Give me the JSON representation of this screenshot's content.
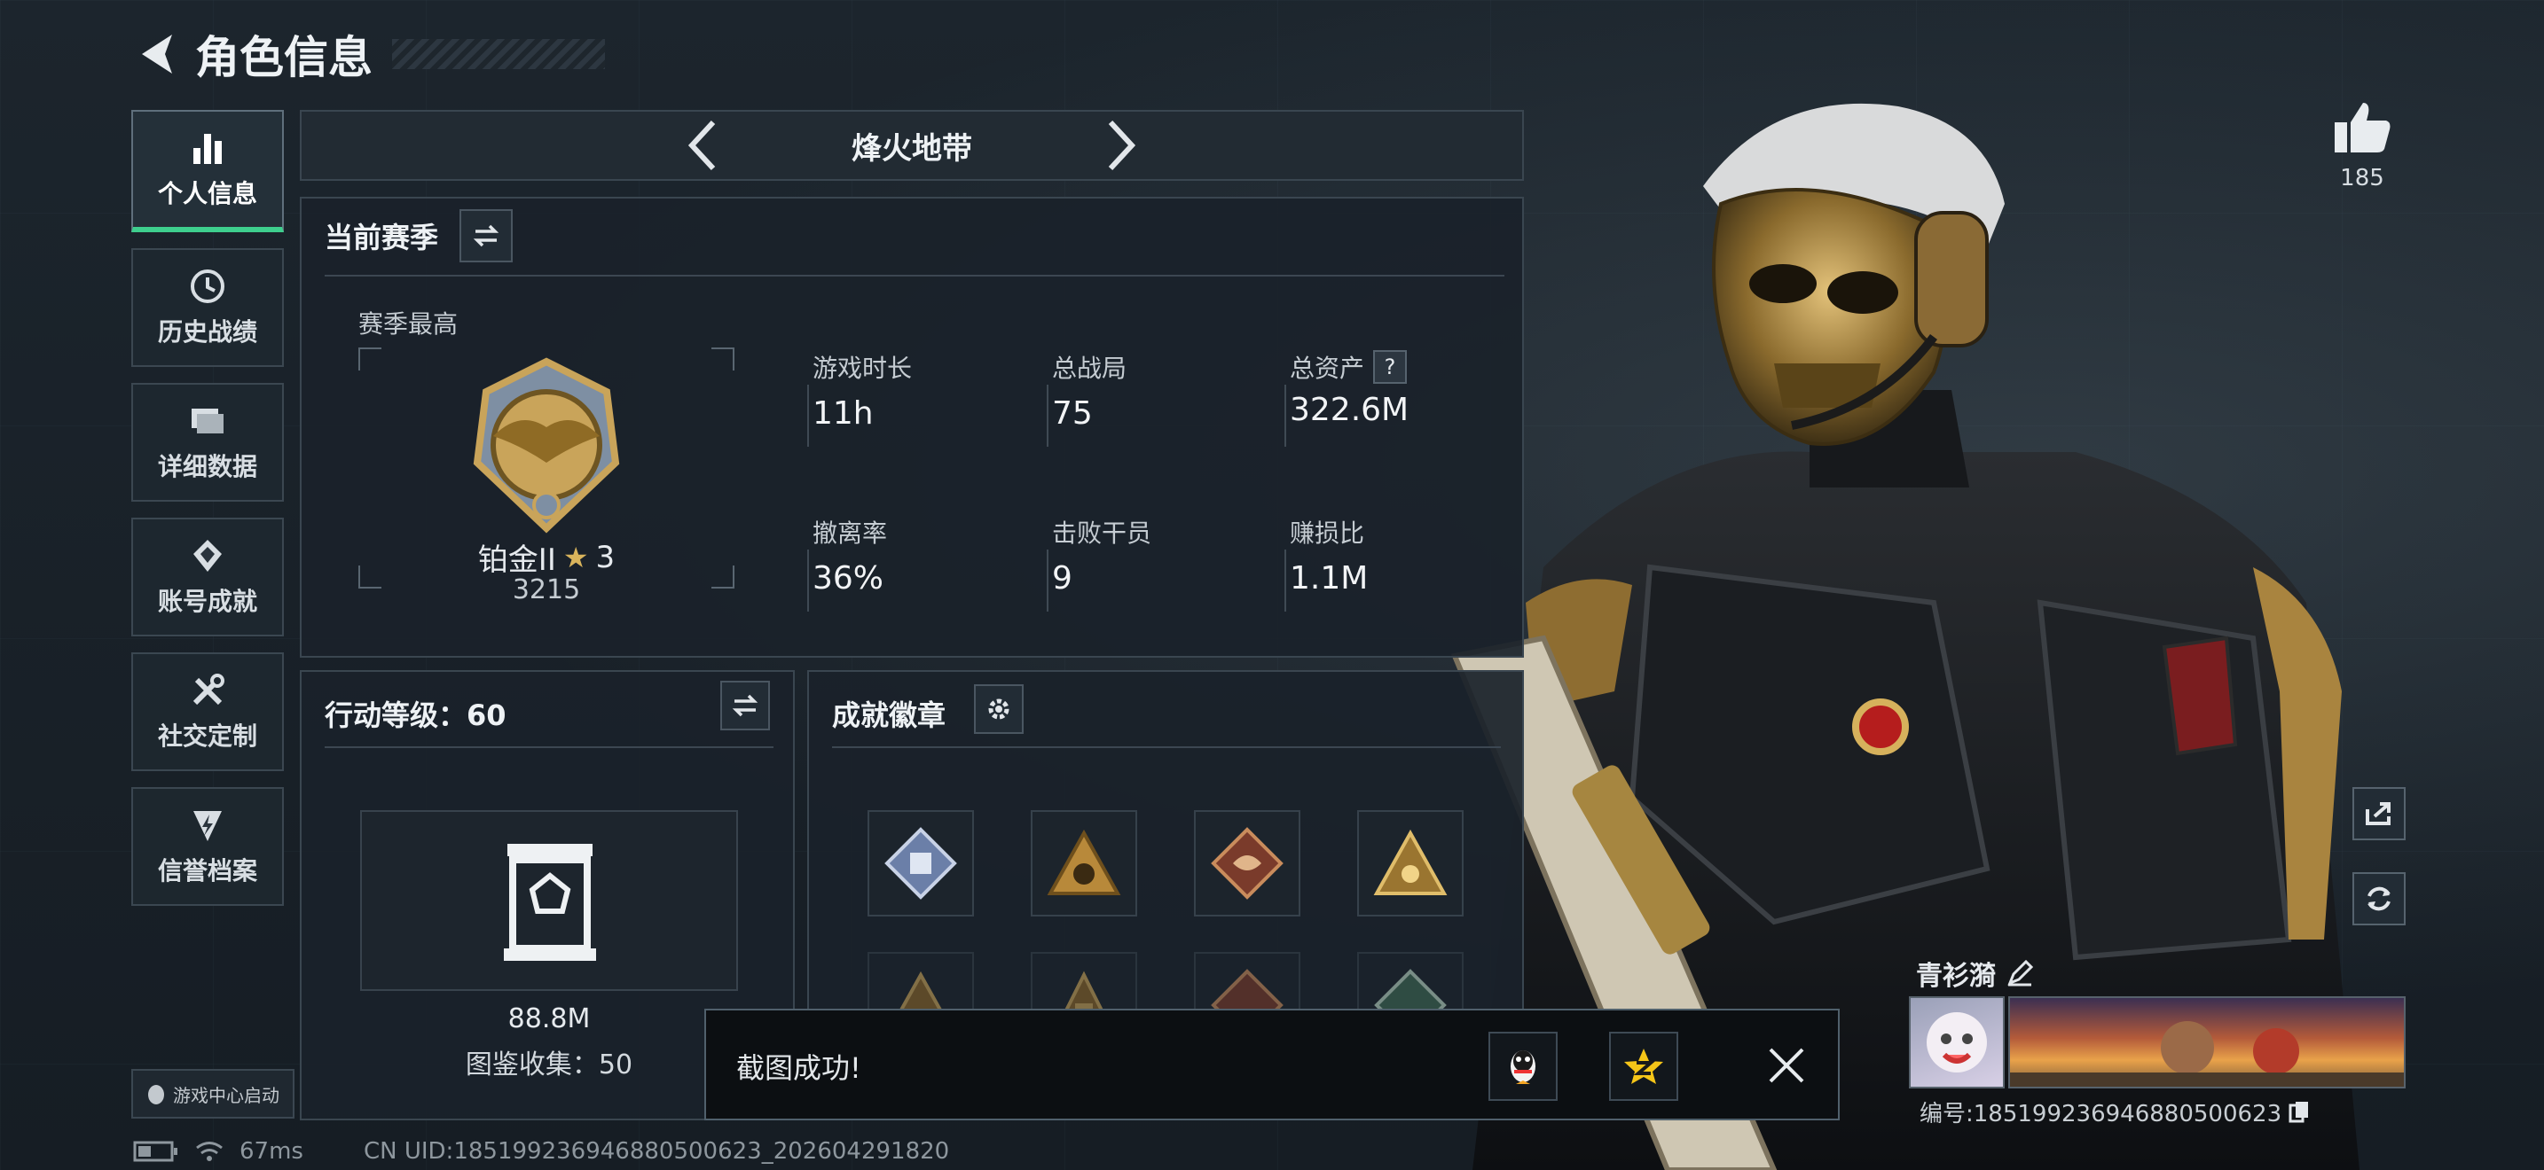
{
  "header": {
    "title": "角色信息"
  },
  "sidebar": {
    "items": [
      {
        "label": "个人信息",
        "active": true
      },
      {
        "label": "历史战绩"
      },
      {
        "label": "详细数据"
      },
      {
        "label": "账号成就"
      },
      {
        "label": "社交定制"
      },
      {
        "label": "信誉档案"
      }
    ],
    "launch_label": "游戏中心启动"
  },
  "mode": {
    "name": "烽火地带"
  },
  "season": {
    "title": "当前赛季",
    "best_label": "赛季最高",
    "rank_name": "铂金II",
    "rank_stars": "3",
    "rank_points": "3215",
    "stats": [
      {
        "label": "游戏时长",
        "value": "11h"
      },
      {
        "label": "总战局",
        "value": "75"
      },
      {
        "label": "总资产",
        "value": "322.6M",
        "help": "?"
      },
      {
        "label": "撤离率",
        "value": "36%"
      },
      {
        "label": "击败干员",
        "value": "9"
      },
      {
        "label": "赚损比",
        "value": "1.1M"
      }
    ]
  },
  "level": {
    "title": "行动等级：60",
    "value": "88.8M",
    "collection": "图鉴收集：50"
  },
  "badges": {
    "title": "成就徽章"
  },
  "likes": {
    "count": "185"
  },
  "player": {
    "name": "青衫漪",
    "id_label": "编号:185199236946880500623"
  },
  "toast": {
    "text": "截图成功!"
  },
  "footer": {
    "ping": "67ms",
    "uid": "CN UID:185199236946880500623_202604291820"
  },
  "colors": {
    "accent": "#3ecf8e",
    "gold": "#c9a45a",
    "toast_bg": "#0c0f12"
  }
}
